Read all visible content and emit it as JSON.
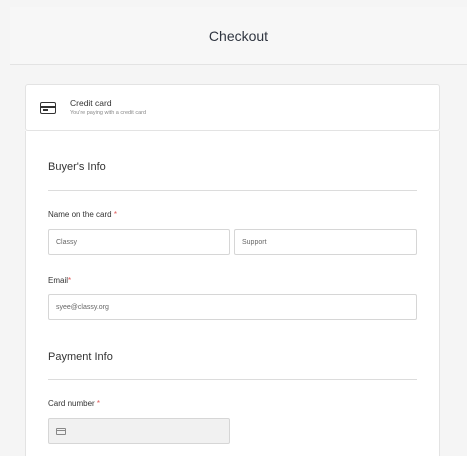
{
  "header": {
    "title": "Checkout"
  },
  "payment_method": {
    "icon": "credit-card-icon",
    "title": "Credit card",
    "subtitle": "You're paying with a credit card"
  },
  "buyer": {
    "section_title": "Buyer's Info",
    "name_label": "Name on the card",
    "first_name_value": "Classy",
    "last_name_value": "Support",
    "email_label": "Email",
    "email_value": "syee@classy.org"
  },
  "payment": {
    "section_title": "Payment Info",
    "card_number_label": "Card number",
    "card_icon": "credit-card-icon"
  },
  "required_marker": "*",
  "colors": {
    "required": "#e05a5a",
    "background": "#f5f5f5",
    "border": "#e3e3e3"
  }
}
